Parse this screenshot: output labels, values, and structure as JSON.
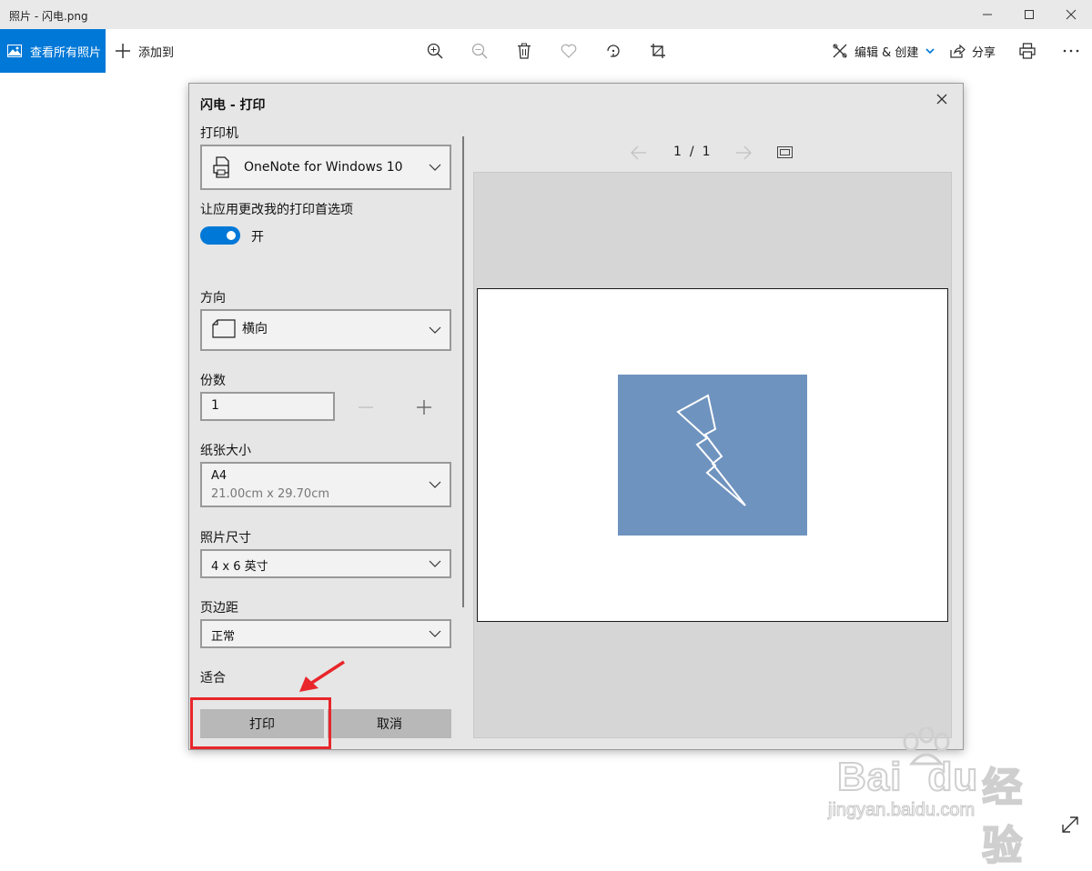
{
  "window": {
    "title": "照片 - 闪电.png"
  },
  "toolbar": {
    "view_all_label": "查看所有照片",
    "add_label": "添加到",
    "edit_create_label": "编辑 & 创建",
    "share_label": "分享"
  },
  "dialog": {
    "title": "闪电 - 打印",
    "printer": {
      "label": "打印机",
      "value": "OneNote for Windows 10"
    },
    "app_prefs": {
      "label": "让应用更改我的打印首选项",
      "toggle_state": "开",
      "on": true
    },
    "orientation": {
      "label": "方向",
      "value": "横向"
    },
    "copies": {
      "label": "份数",
      "value": "1"
    },
    "paper_size": {
      "label": "纸张大小",
      "value": "A4",
      "detail": "21.00cm x 29.70cm"
    },
    "photo_size": {
      "label": "照片尺寸",
      "value": "4 x 6 英寸"
    },
    "margins": {
      "label": "页边距",
      "value": "正常"
    },
    "fit": {
      "label": "适合"
    },
    "print_button": "打印",
    "cancel_button": "取消",
    "pager": {
      "current": "1",
      "separator": "/",
      "total": "1"
    }
  },
  "colors": {
    "accent": "#0078d7",
    "photo_bg": "#6f93bf",
    "annotation": "#e8262b"
  },
  "watermark": {
    "brand": "Bai",
    "brand2": "du",
    "cn": "经验",
    "url": "jingyan.baidu.com"
  }
}
